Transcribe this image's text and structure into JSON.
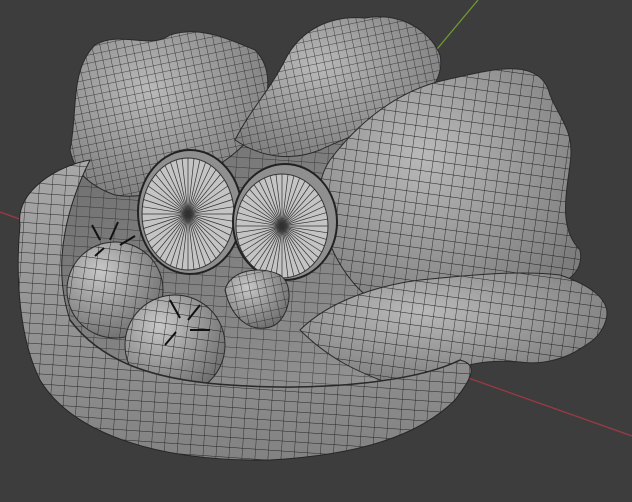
{
  "viewport": {
    "mode": "Edit Mode",
    "shading": "solid-wireframe",
    "background_color": "#3d3d3d",
    "mesh_color": "#9a9a9a",
    "wire_color": "#1e1e1e",
    "axis_x_color": "#9a3a45",
    "axis_y_color": "#6f9a2e",
    "objects": [
      {
        "name": "salad-bowl",
        "type": "mesh"
      },
      {
        "name": "lettuce-leaf-left",
        "type": "mesh"
      },
      {
        "name": "lettuce-leaf-top",
        "type": "mesh"
      },
      {
        "name": "lettuce-leaf-right",
        "type": "mesh"
      },
      {
        "name": "lettuce-leaf-front",
        "type": "mesh"
      },
      {
        "name": "cucumber-slice-left",
        "type": "mesh"
      },
      {
        "name": "cucumber-slice-right",
        "type": "mesh"
      },
      {
        "name": "tomato-back",
        "type": "mesh"
      },
      {
        "name": "tomato-front",
        "type": "mesh"
      },
      {
        "name": "olive",
        "type": "mesh"
      }
    ]
  }
}
